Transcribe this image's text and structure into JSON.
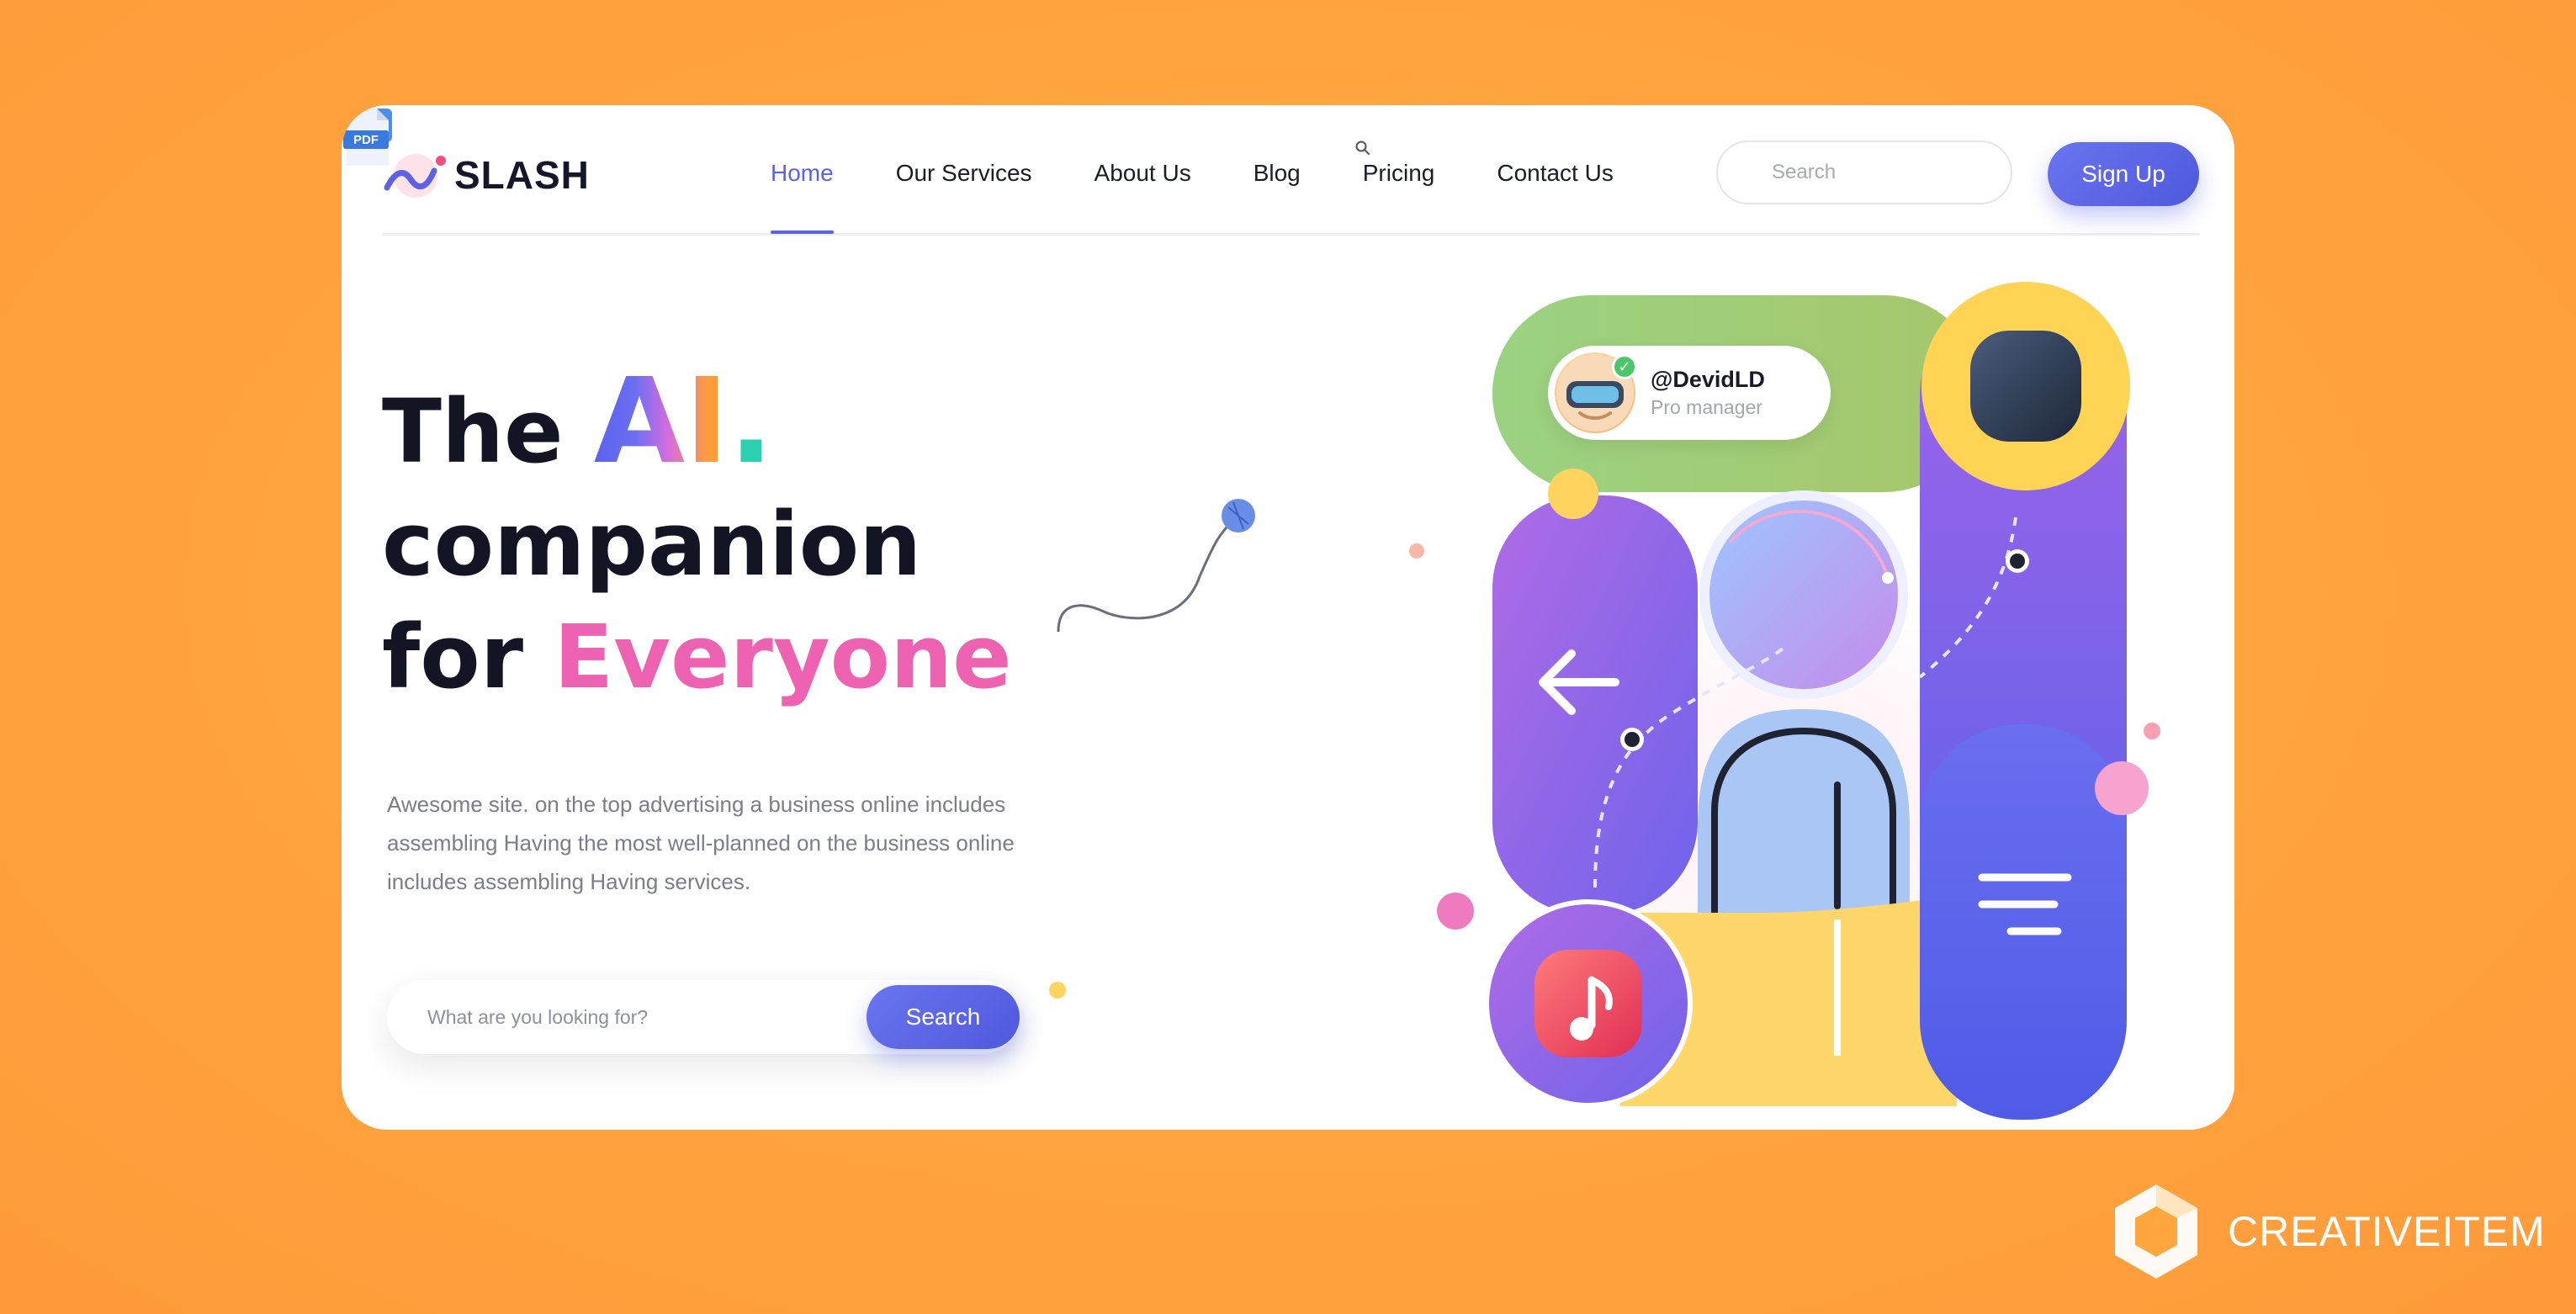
{
  "brand": {
    "logo_text": "SLASH",
    "watermark": "CREATIVEITEM"
  },
  "nav": {
    "items": [
      {
        "label": "Home",
        "active": true
      },
      {
        "label": "Our Services",
        "active": false
      },
      {
        "label": "About Us",
        "active": false
      },
      {
        "label": "Blog",
        "active": false
      },
      {
        "label": "Pricing",
        "active": false
      },
      {
        "label": "Contact Us",
        "active": false
      }
    ]
  },
  "header_search": {
    "placeholder": "Search"
  },
  "signup": {
    "label": "Sign Up"
  },
  "hero": {
    "title_the": "The",
    "title_ai": "AI",
    "title_dot": ".",
    "title_line2": "companion",
    "title_for": "for",
    "title_everyone": "Everyone",
    "description": "Awesome  site. on the top advertising a business online includes assembling Having the most well-planned on the business online includes assembling Having services.",
    "search_placeholder": "What are you looking for?",
    "search_button": "Search"
  },
  "profile": {
    "handle": "@DevidLD",
    "role": "Pro manager"
  },
  "pdf_label": "PDF",
  "colors": {
    "accent": "#5b62e6",
    "pink": "#ee63b1",
    "teal_dot": "#2bd0b0",
    "background": "#ffa63f"
  }
}
